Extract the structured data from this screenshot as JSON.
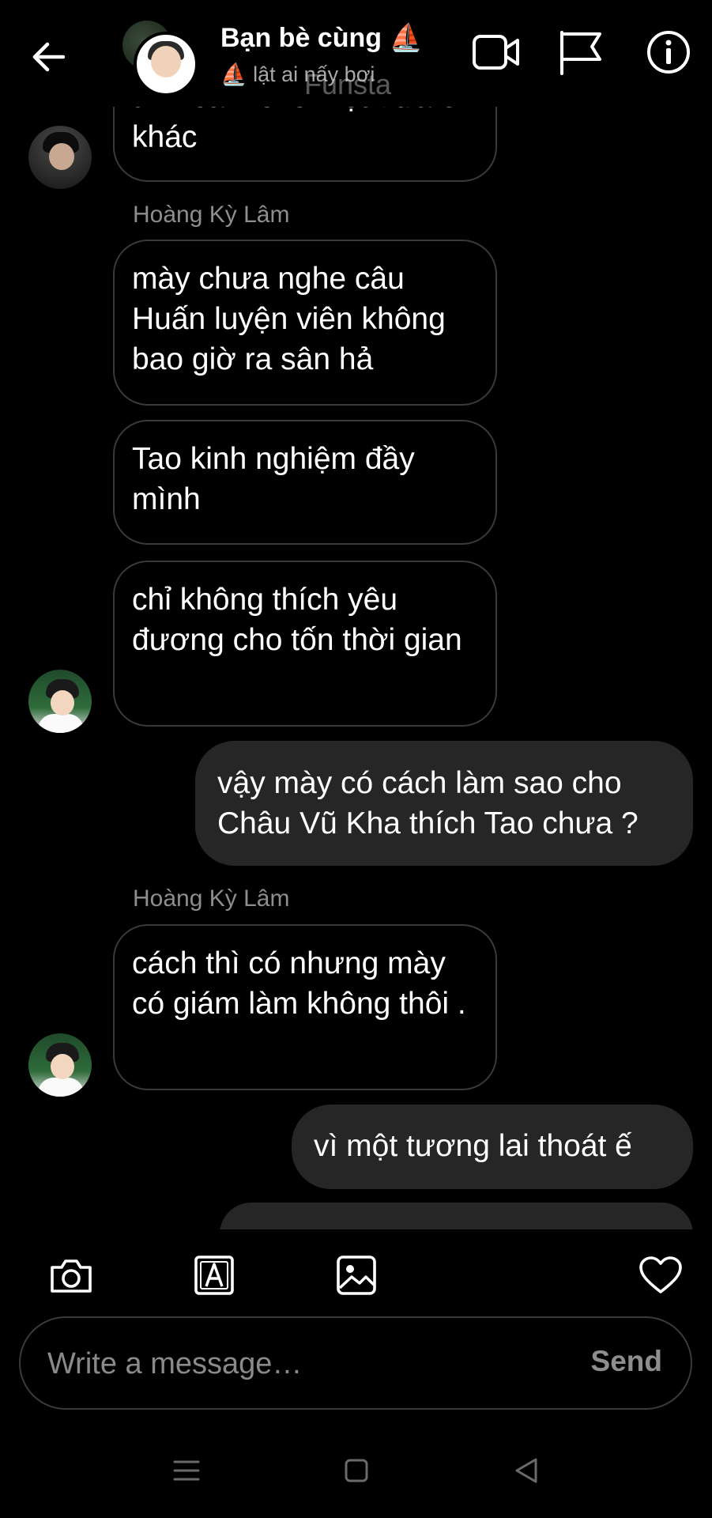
{
  "header": {
    "title": "Bạn bè cùng ⛵",
    "subtitle": "⛵ lật ai nấy bơi",
    "watermark": "Funsta"
  },
  "messages": [
    {
      "type": "in",
      "text": "tình cảm cho một đứa ế khác"
    },
    {
      "type": "sender",
      "text": "Hoàng Kỳ Lâm"
    },
    {
      "type": "in",
      "text": "mày chưa nghe câu Huấn luyện viên không bao giờ ra sân hả"
    },
    {
      "type": "in",
      "text": "Tao kinh nghiệm đầy mình"
    },
    {
      "type": "in",
      "text": "chỉ không thích yêu đương cho tốn thời gian"
    },
    {
      "type": "out",
      "text": "vậy mày có cách  làm sao cho Châu Vũ Kha thích Tao chưa ?"
    },
    {
      "type": "sender",
      "text": "Hoàng Kỳ Lâm"
    },
    {
      "type": "in",
      "text": "cách thì có nhưng mày có giám làm không thôi ."
    },
    {
      "type": "out",
      "text": "vì một tương lai thoát ế"
    }
  ],
  "composer": {
    "placeholder": "Write a message…",
    "send_label": "Send"
  }
}
